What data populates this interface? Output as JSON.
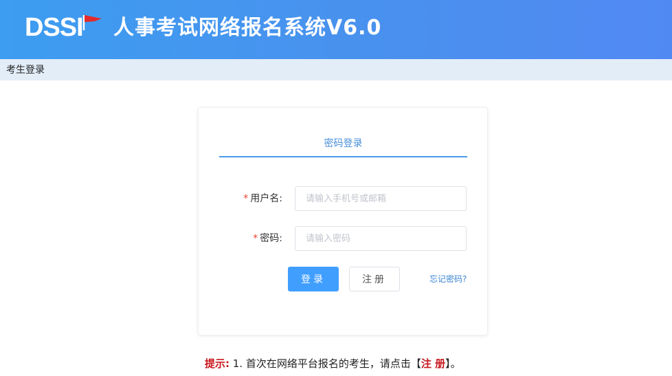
{
  "header": {
    "logo_text": "DSSI",
    "title": "人事考试网络报名系统V6.0"
  },
  "breadcrumb": {
    "label": "考生登录"
  },
  "login": {
    "tab_label": "密码登录",
    "username_label": "用户名:",
    "username_required": "*",
    "username_placeholder": "请输入手机号或邮箱",
    "password_label": "密码:",
    "password_required": "*",
    "password_placeholder": "请输入密码",
    "login_button": "登录",
    "register_button": "注册",
    "forgot_link": "忘记密码?"
  },
  "hint": {
    "label": "提示:",
    "text_before": " 1. 首次在网络平台报名的考生，请点击【",
    "link_text": "注 册",
    "text_after": "】。"
  },
  "colors": {
    "header_start": "#3d9df0",
    "header_end": "#5189f3",
    "primary_button": "#409eff",
    "required_star": "#e8412e",
    "hint_red": "#c8161d"
  }
}
